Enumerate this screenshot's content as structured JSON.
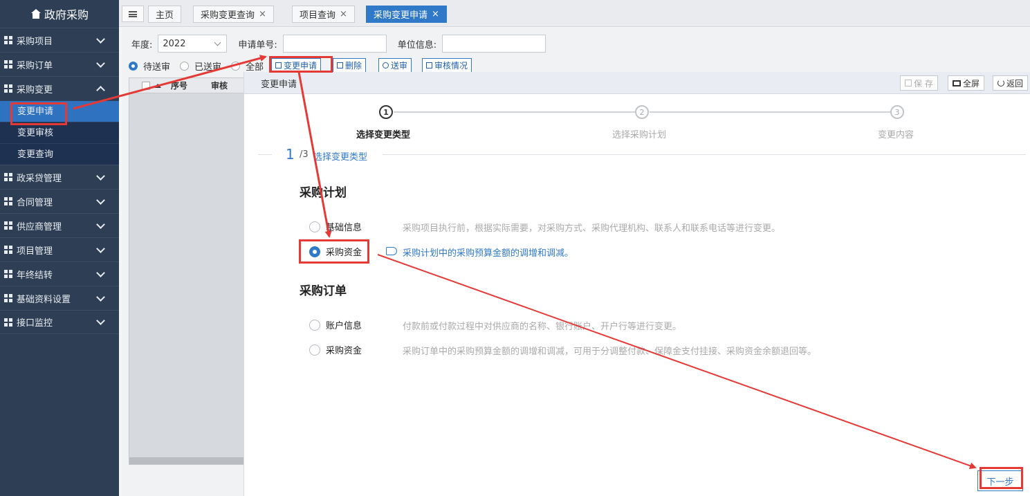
{
  "sidebar": {
    "brand": "政府采购",
    "menu": [
      {
        "label": "采购项目"
      },
      {
        "label": "采购订单"
      },
      {
        "label": "采购变更"
      }
    ],
    "submenu": [
      {
        "label": "变更申请"
      },
      {
        "label": "变更审核"
      },
      {
        "label": "变更查询"
      }
    ],
    "menu_rest": [
      {
        "label": "政采贷管理"
      },
      {
        "label": "合同管理"
      },
      {
        "label": "供应商管理"
      },
      {
        "label": "项目管理"
      },
      {
        "label": "年终结转"
      },
      {
        "label": "基础资料设置"
      },
      {
        "label": "接口监控"
      }
    ]
  },
  "tabs": [
    {
      "label": "主页"
    },
    {
      "label": "采购变更查询",
      "close": "×"
    },
    {
      "label": "项目查询",
      "close": "×"
    },
    {
      "label": "采购变更申请",
      "close": "×"
    }
  ],
  "filters": {
    "year_label": "年度:",
    "year_value": "2022",
    "apply_no_label": "申请单号:",
    "unit_label": "单位信息:"
  },
  "status_radios": [
    "待送审",
    "已送审",
    "全部"
  ],
  "toolbar": {
    "change_apply": "变更申请",
    "delete": "删除",
    "submit": "送审",
    "review_status": "审核情况"
  },
  "grid": {
    "col_no": "序号",
    "col_review": "审核"
  },
  "panel": {
    "title": "变更申请",
    "save": "保 存",
    "fullscreen": "全屏",
    "back": "返回",
    "steps": [
      {
        "num": "1",
        "label": "选择变更类型"
      },
      {
        "num": "2",
        "label": "选择采购计划"
      },
      {
        "num": "3",
        "label": "变更内容"
      }
    ],
    "section": {
      "current": "1",
      "total": "/3",
      "name": "选择变更类型"
    },
    "groups": [
      {
        "title": "采购计划",
        "options": [
          {
            "label": "基础信息",
            "desc": "采购项目执行前，根据实际需要，对采购方式、采购代理机构、联系人和联系电话等进行变更。",
            "selected": false
          },
          {
            "label": "采购资金",
            "desc": "采购计划中的采购预算金额的调增和调减。",
            "selected": true
          }
        ]
      },
      {
        "title": "采购订单",
        "options": [
          {
            "label": "账户信息",
            "desc": "付款前或付款过程中对供应商的名称、银行账户、开户行等进行变更。",
            "selected": false
          },
          {
            "label": "采购资金",
            "desc": "采购订单中的采购预算金额的调增和调减，可用于分调整付款、保障金支付挂接、采购资金余额退回等。",
            "selected": false
          }
        ]
      }
    ],
    "next": "下一步"
  },
  "colors": {
    "accent": "#2f79c8",
    "sidebar": "#2e3f55",
    "annotation": "#e53935"
  }
}
